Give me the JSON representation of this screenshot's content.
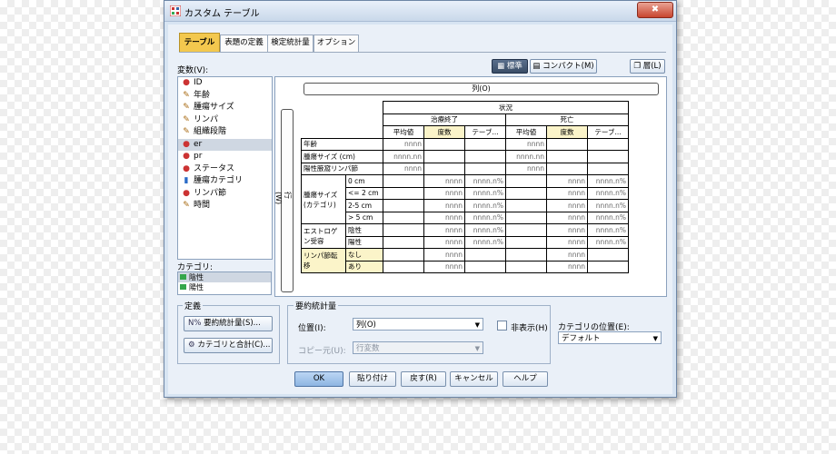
{
  "window": {
    "title": "カスタム テーブル",
    "close_label": "✖"
  },
  "tabs": [
    "テーブル",
    "表題の定義",
    "検定統計量",
    "オプション"
  ],
  "variables": {
    "label": "変数(V):",
    "items": [
      {
        "icon": "nominal-icon",
        "name": "ID"
      },
      {
        "icon": "scale-icon",
        "name": "年齢"
      },
      {
        "icon": "scale-icon",
        "name": "腫瘍サイズ"
      },
      {
        "icon": "scale-icon",
        "name": "リンパ"
      },
      {
        "icon": "scale-icon",
        "name": "組織段階"
      },
      {
        "icon": "nominal-icon",
        "name": "er"
      },
      {
        "icon": "nominal-icon",
        "name": "pr"
      },
      {
        "icon": "nominal-icon",
        "name": "ステータス"
      },
      {
        "icon": "ordinal-icon",
        "name": "腫瘍カテゴリ"
      },
      {
        "icon": "nominal-icon",
        "name": "リンパ節"
      },
      {
        "icon": "scale-icon",
        "name": "時間"
      }
    ]
  },
  "categories": {
    "label": "カテゴリ:",
    "items": [
      "陰性",
      "陽性"
    ]
  },
  "view_buttons": {
    "normal": "標準",
    "compact": "コンパクト(M)",
    "layer": "層(L)"
  },
  "table_canvas": {
    "column_label": "列(O)",
    "row_label": "行(W)",
    "header": {
      "status": "状況",
      "groups": [
        "治療終了",
        "死亡"
      ],
      "stats": [
        "平均値",
        "度数",
        "テーブ..."
      ]
    },
    "rows": [
      {
        "label": "年齢",
        "cells": [
          "nnnn",
          "",
          "",
          "nnnn",
          "",
          ""
        ]
      },
      {
        "label": "腫瘍サイズ (cm)",
        "cells": [
          "nnnn.nn",
          "",
          "",
          "nnnn.nn",
          "",
          ""
        ]
      },
      {
        "label": "陽性腋窩リンパ節",
        "cells": [
          "nnnn",
          "",
          "",
          "nnnn",
          "",
          ""
        ]
      }
    ],
    "groups": [
      {
        "label": "腫瘍サイズ (カテゴリ)",
        "rows": [
          {
            "label": "0 cm",
            "cells": [
              "",
              "nnnn",
              "nnnn.n%",
              "",
              "nnnn",
              "nnnn.n%"
            ]
          },
          {
            "label": "<= 2 cm",
            "cells": [
              "",
              "nnnn",
              "nnnn.n%",
              "",
              "nnnn",
              "nnnn.n%"
            ]
          },
          {
            "label": "2-5 cm",
            "cells": [
              "",
              "nnnn",
              "nnnn.n%",
              "",
              "nnnn",
              "nnnn.n%"
            ]
          },
          {
            "label": "> 5 cm",
            "cells": [
              "",
              "nnnn",
              "nnnn.n%",
              "",
              "nnnn",
              "nnnn.n%"
            ]
          }
        ]
      },
      {
        "label": "エストロゲン受容",
        "rows": [
          {
            "label": "陰性",
            "cells": [
              "",
              "nnnn",
              "nnnn.n%",
              "",
              "nnnn",
              "nnnn.n%"
            ]
          },
          {
            "label": "陽性",
            "cells": [
              "",
              "nnnn",
              "nnnn.n%",
              "",
              "nnnn",
              "nnnn.n%"
            ]
          }
        ]
      },
      {
        "label": "リンパ節転移",
        "rows": [
          {
            "label": "なし",
            "cells": [
              "",
              "nnnn",
              "",
              "",
              "nnnn",
              ""
            ]
          },
          {
            "label": "あり",
            "cells": [
              "",
              "nnnn",
              "",
              "",
              "nnnn",
              ""
            ]
          }
        ]
      }
    ]
  },
  "definition": {
    "title": "定義",
    "summary_button": "要約統計量(S)...",
    "categories_button": "カテゴリと合計(C)..."
  },
  "summary_stats": {
    "title": "要約統計量",
    "position_label": "位置(I):",
    "position_value": "列(O)",
    "hide_label": "非表示(H)",
    "source_label": "コピー元(U):",
    "source_value": "行変数"
  },
  "category_position": {
    "label": "カテゴリの位置(E):",
    "value": "デフォルト"
  },
  "buttons": {
    "ok": "OK",
    "paste": "貼り付け",
    "reset": "戻す(R)",
    "cancel": "キャンセル",
    "help": "ヘルプ"
  },
  "colors": {
    "tab_active": "#f3c84e",
    "window_bg": "#d7e4f2",
    "ok_button": "#8db5e2"
  }
}
